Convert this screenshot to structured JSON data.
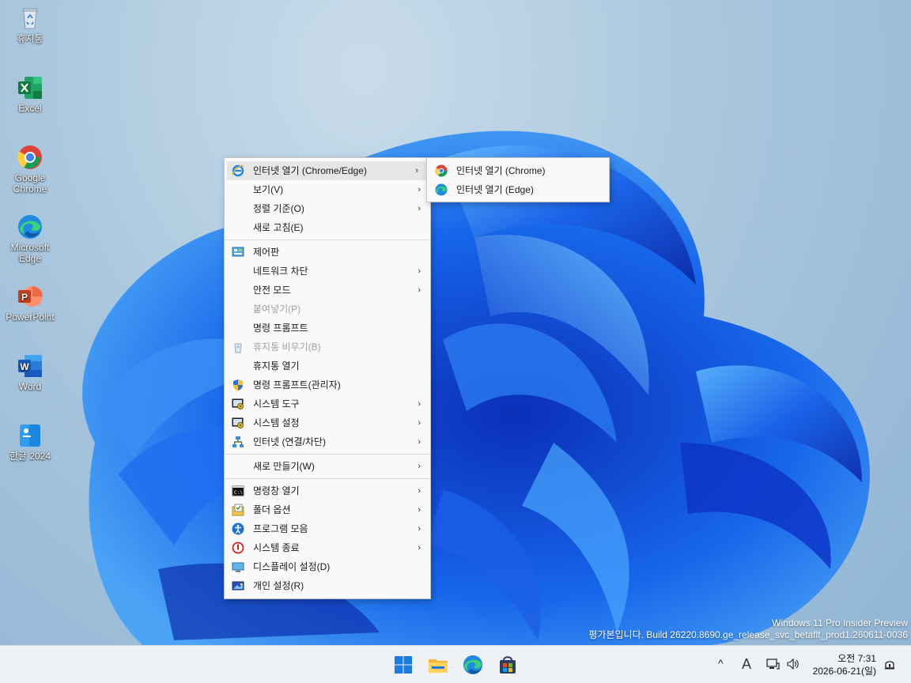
{
  "desktop": {
    "icons": [
      {
        "label": "휴지통",
        "icon": "recycle-bin-icon"
      },
      {
        "label": "Excel",
        "icon": "excel-icon"
      },
      {
        "label": "Google\nChrome",
        "line1": "Google",
        "line2": "Chrome",
        "icon": "chrome-icon"
      },
      {
        "label": "Microsoft Edge",
        "line1": "Microsoft",
        "line2": "Edge",
        "icon": "edge-icon"
      },
      {
        "label": "PowerPoint",
        "icon": "powerpoint-icon"
      },
      {
        "label": "Word",
        "icon": "word-icon"
      },
      {
        "label": "한글 2024",
        "icon": "hangul-icon"
      }
    ]
  },
  "context_menu": {
    "items": [
      {
        "label": "인터넷 열기 (Chrome/Edge)",
        "icon": "ie-icon",
        "submenu": true,
        "highlighted": true
      },
      {
        "label": "보기(V)",
        "submenu": true
      },
      {
        "label": "정렬 기준(O)",
        "submenu": true
      },
      {
        "label": "새로 고침(E)"
      },
      {
        "label": "제어판",
        "icon": "control-panel-icon"
      },
      {
        "label": "네트워크 차단",
        "submenu": true
      },
      {
        "label": "안전 모드",
        "submenu": true
      },
      {
        "label": "붙여넣기(P)",
        "disabled": true
      },
      {
        "label": "명령 프롬프트"
      },
      {
        "label": "휴지통 비우기(B)",
        "icon": "recycle-bin-icon",
        "disabled": true
      },
      {
        "label": "휴지통 열기"
      },
      {
        "label": "명령 프롬프트(관리자)",
        "icon": "shield-icon"
      },
      {
        "label": "시스템 도구",
        "icon": "system-tools-icon",
        "submenu": true
      },
      {
        "label": "시스템 설정",
        "icon": "system-settings-icon",
        "submenu": true
      },
      {
        "label": "인터넷 (연결/차단)",
        "icon": "network-icon",
        "submenu": true
      },
      {
        "label": "새로 만들기(W)",
        "submenu": true
      },
      {
        "label": "명령창 열기",
        "icon": "cmd-icon",
        "submenu": true
      },
      {
        "label": "폴더 옵션",
        "icon": "folder-options-icon",
        "submenu": true
      },
      {
        "label": "프로그램 모음",
        "icon": "accessibility-icon",
        "submenu": true
      },
      {
        "label": "시스템 종료",
        "icon": "power-icon",
        "submenu": true
      },
      {
        "label": "디스플레이 설정(D)",
        "icon": "display-icon"
      },
      {
        "label": "개인 설정(R)",
        "icon": "personalize-icon"
      }
    ]
  },
  "submenu": {
    "items": [
      {
        "label": "인터넷 열기 (Chrome)",
        "icon": "chrome-icon"
      },
      {
        "label": "인터넷 열기 (Edge)",
        "icon": "edge-icon"
      }
    ]
  },
  "watermark": {
    "line1": "Windows 11 Pro Insider Preview",
    "line2": "평가본입니다. Build 26220.8690.ge_release_svc_betaflt_prod1.260611-0036"
  },
  "taskbar": {
    "apps": [
      "start-icon",
      "file-explorer-icon",
      "edge-icon",
      "store-icon"
    ],
    "tray": {
      "chevron": "^",
      "ime": "A",
      "time": "오전 7:31",
      "date": "2026-06-21(일)"
    }
  },
  "colors": {
    "menu_bg": "#f9f9f9",
    "highlight": "#e6e6e6",
    "taskbar_bg": "#eef1f5",
    "bloom": "#1552e0"
  }
}
